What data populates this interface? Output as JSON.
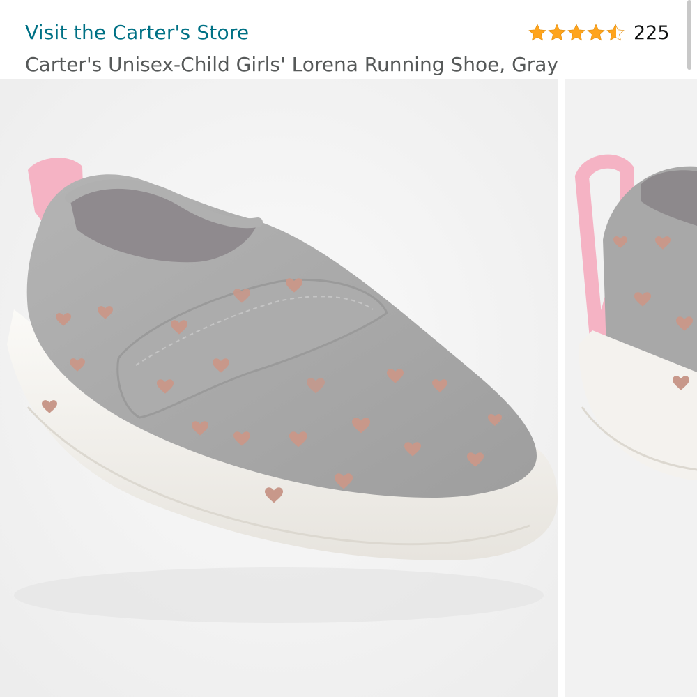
{
  "header": {
    "store_link": "Visit the Carter's Store",
    "product_title": "Carter's Unisex-Child Girls' Lorena Running Shoe, Gray",
    "rating": {
      "stars": 4.5,
      "count": "225",
      "star_color": "#FFA41C"
    }
  },
  "colors": {
    "link": "#007185",
    "title": "#565959",
    "shoe_gray": "#a9a9a9",
    "sole": "#f4f2ee",
    "pull_tab": "#f7b6c6",
    "hearts": "#c99a8a"
  },
  "images": [
    {
      "name": "product-image-main"
    },
    {
      "name": "product-image-next"
    }
  ]
}
